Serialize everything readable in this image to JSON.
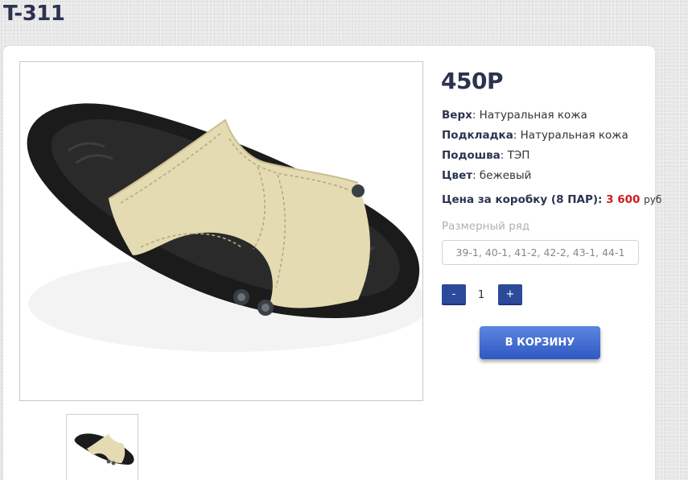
{
  "product": {
    "title": "T-311",
    "price": "450Р",
    "attributes": [
      {
        "label": "Верх",
        "value": ": Натуральная кожа"
      },
      {
        "label": "Подкладка",
        "value": ": Натуральная кожа"
      },
      {
        "label": "Подошва",
        "value": ": ТЭП"
      },
      {
        "label": "Цвет",
        "value": ": бежевый"
      }
    ],
    "box_price": {
      "label": "Цена за коробку (8 ПАР):",
      "value": "3 600",
      "unit": "руб"
    }
  },
  "size": {
    "label": "Размерный ряд",
    "selected": "39-1, 40-1, 41-2, 42-2, 43-1, 44-1"
  },
  "quantity": {
    "minus_label": "-",
    "value": "1",
    "plus_label": "+"
  },
  "cart": {
    "button_label": "В КОРЗИНУ"
  },
  "colors": {
    "accent": "#2c4a9a",
    "price_red": "#cc1f1f",
    "title": "#2b3350"
  }
}
